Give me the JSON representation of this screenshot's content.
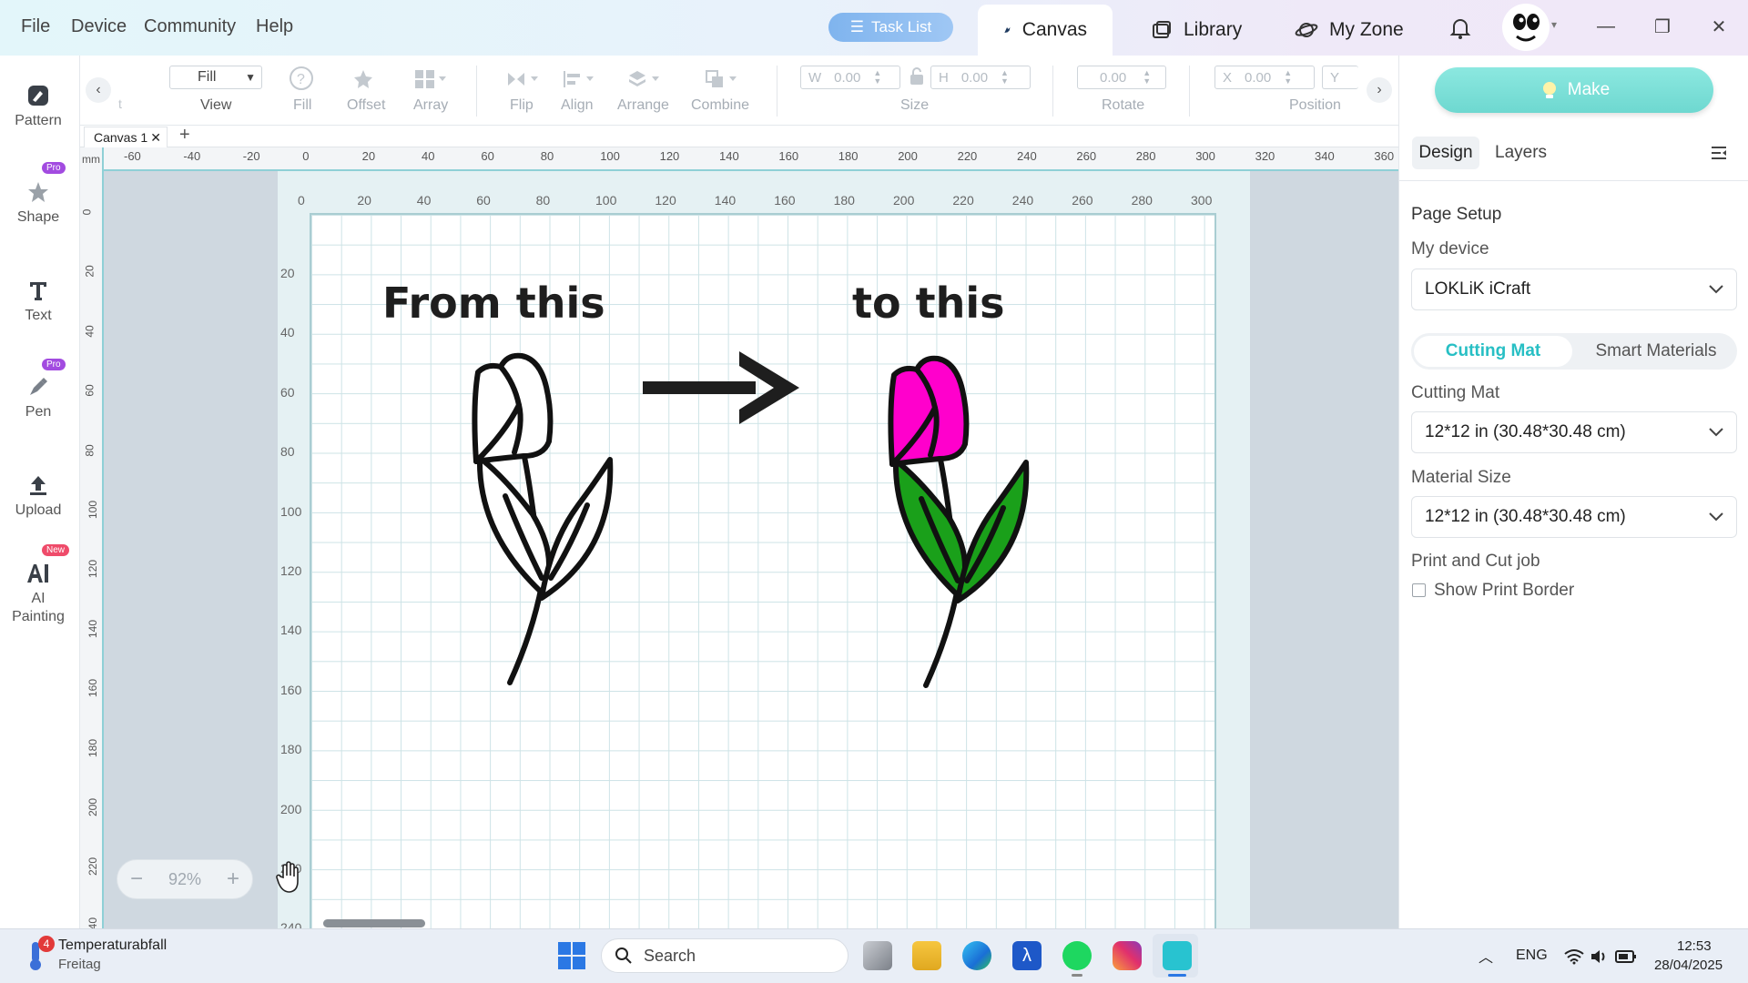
{
  "menu": {
    "file": "File",
    "device": "Device",
    "community": "Community",
    "help": "Help"
  },
  "header": {
    "task_list": "Task List",
    "tabs": [
      {
        "label": "Canvas"
      },
      {
        "label": "Library"
      },
      {
        "label": "My Zone"
      }
    ]
  },
  "sidebar": {
    "items": [
      {
        "label": "Pattern",
        "badge": ""
      },
      {
        "label": "Shape",
        "badge": "Pro"
      },
      {
        "label": "Text",
        "badge": ""
      },
      {
        "label": "Pen",
        "badge": "Pro"
      },
      {
        "label": "Upload",
        "badge": ""
      },
      {
        "label": "AI Painting",
        "badge": "New"
      }
    ]
  },
  "toolbar": {
    "view_value": "Fill",
    "view_label": "View",
    "fill": "Fill",
    "offset": "Offset",
    "array": "Array",
    "flip": "Flip",
    "align": "Align",
    "arrange": "Arrange",
    "combine": "Combine",
    "w_label": "W",
    "w_value": "0.00",
    "h_label": "H",
    "h_value": "0.00",
    "size_label": "Size",
    "rotate_value": "0.00",
    "rotate_label": "Rotate",
    "x_label": "X",
    "x_value": "0.00",
    "y_label": "Y",
    "position_label": "Position",
    "cut_text": "t"
  },
  "canvas": {
    "tab_name": "Canvas 1",
    "unit": "mm",
    "ruler_top": [
      "-60",
      "-40",
      "-20",
      "0",
      "20",
      "40",
      "60",
      "80",
      "100",
      "120",
      "140",
      "160",
      "180",
      "200",
      "220",
      "240",
      "260",
      "280",
      "300",
      "320",
      "340",
      "360"
    ],
    "ruler_left": [
      "0",
      "20",
      "40",
      "60",
      "80",
      "100",
      "120",
      "140",
      "160",
      "180",
      "200",
      "220",
      "240"
    ],
    "mat_top": [
      "0",
      "20",
      "40",
      "60",
      "80",
      "100",
      "120",
      "140",
      "160",
      "180",
      "200",
      "220",
      "240",
      "260",
      "280",
      "300"
    ],
    "mat_left": [
      "20",
      "40",
      "60",
      "80",
      "100",
      "120",
      "140",
      "160",
      "180",
      "200",
      "220",
      "240"
    ],
    "text_from": "From this",
    "text_to": "to this",
    "zoom": "92%",
    "colors": {
      "petal": "#ff00cc",
      "leaf": "#1aa01a",
      "outline": "#111111"
    }
  },
  "rpanel": {
    "make": "Make",
    "tab_design": "Design",
    "tab_layers": "Layers",
    "page_setup": "Page Setup",
    "my_device": "My device",
    "device_value": "LOKLiK iCraft",
    "seg_cutting": "Cutting Mat",
    "seg_smart": "Smart Materials",
    "cutting_mat_label": "Cutting Mat",
    "cutting_mat_value": "12*12 in (30.48*30.48 cm)",
    "material_size_label": "Material Size",
    "material_size_value": "12*12 in (30.48*30.48 cm)",
    "print_cut": "Print and Cut job",
    "show_border": "Show Print Border"
  },
  "taskbar": {
    "weather_title": "Temperaturabfall",
    "weather_sub": "Freitag",
    "weather_badge": "4",
    "search": "Search",
    "lang": "ENG",
    "time": "12:53",
    "date": "28/04/2025"
  }
}
